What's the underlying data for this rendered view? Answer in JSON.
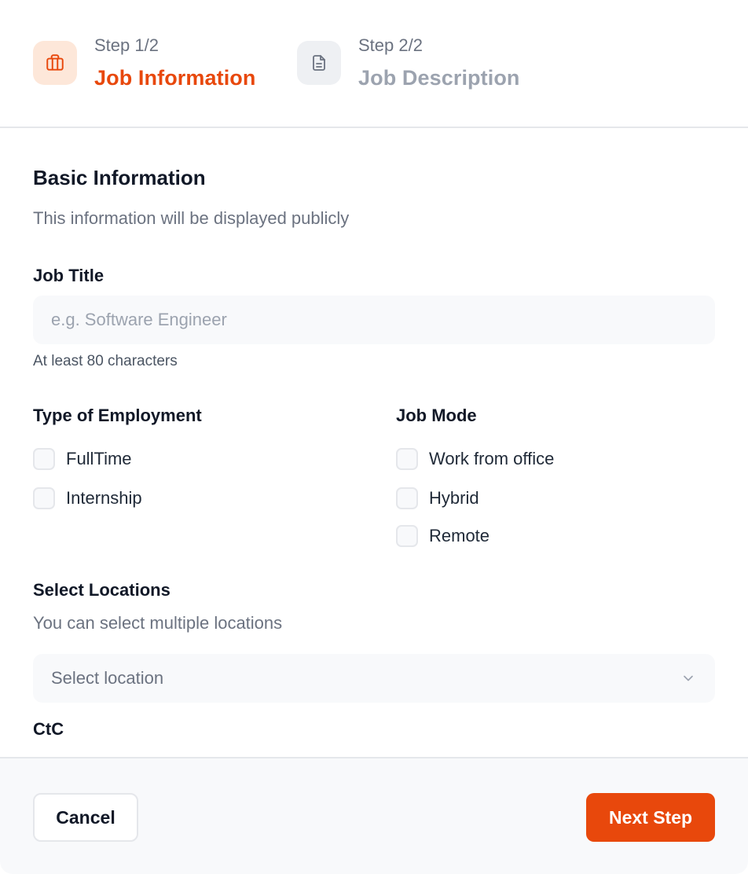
{
  "stepper": {
    "steps": [
      {
        "count": "Step 1/2",
        "title": "Job Information",
        "icon": "briefcase-icon",
        "active": true
      },
      {
        "count": "Step 2/2",
        "title": "Job Description",
        "icon": "document-icon",
        "active": false
      }
    ]
  },
  "basic_info": {
    "title": "Basic Information",
    "subtitle": "This information will be displayed publicly"
  },
  "job_title": {
    "label": "Job Title",
    "value": "",
    "placeholder": "e.g. Software Engineer",
    "hint": "At least 80 characters"
  },
  "employment": {
    "label": "Type of Employment",
    "options": [
      "FullTime",
      "Internship"
    ]
  },
  "job_mode": {
    "label": "Job Mode",
    "options": [
      "Work from office",
      "Hybrid",
      "Remote"
    ]
  },
  "locations": {
    "label": "Select Locations",
    "subtitle": "You can select multiple locations",
    "placeholder": "Select location"
  },
  "ctc": {
    "label": "CtC"
  },
  "footer": {
    "cancel_label": "Cancel",
    "next_label": "Next Step"
  },
  "colors": {
    "accent": "#e8480c",
    "accent_bg": "#fde7d9",
    "muted": "#9ca3af"
  }
}
